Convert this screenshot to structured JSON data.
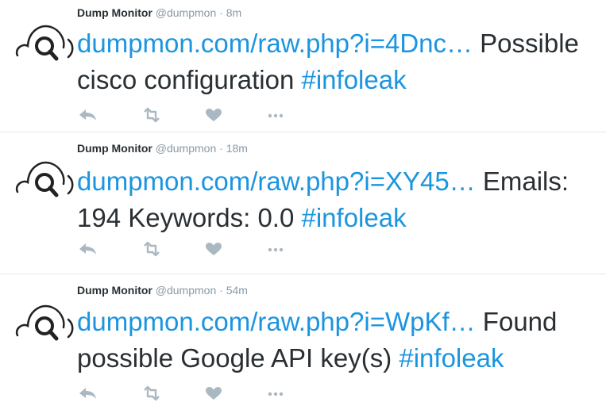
{
  "tweets": [
    {
      "name": "Dump Monitor",
      "handle": "@dumpmon",
      "separator": "·",
      "time": "8m",
      "link": "dumpmon.com/raw.php?i=4Dnc…",
      "text": " Possible cisco configuration ",
      "hashtag": "#infoleak"
    },
    {
      "name": "Dump Monitor",
      "handle": "@dumpmon",
      "separator": "·",
      "time": "18m",
      "link": "dumpmon.com/raw.php?i=XY45…",
      "text": " Emails: 194 Keywords: 0.0 ",
      "hashtag": "#infoleak"
    },
    {
      "name": "Dump Monitor",
      "handle": "@dumpmon",
      "separator": "·",
      "time": "54m",
      "link": "dumpmon.com/raw.php?i=WpKf…",
      "text": " Found possible Google API key(s) ",
      "hashtag": "#infoleak"
    }
  ],
  "icons": {
    "avatar": "cloud-magnifier-icon",
    "reply": "reply-icon",
    "retweet": "retweet-icon",
    "like": "heart-icon",
    "more": "more-dots-icon"
  },
  "colors": {
    "link": "#1b95e0",
    "muted": "#8899a6",
    "action_icon": "#aab8c2",
    "text": "#292f33",
    "divider": "#e1e8ed"
  }
}
